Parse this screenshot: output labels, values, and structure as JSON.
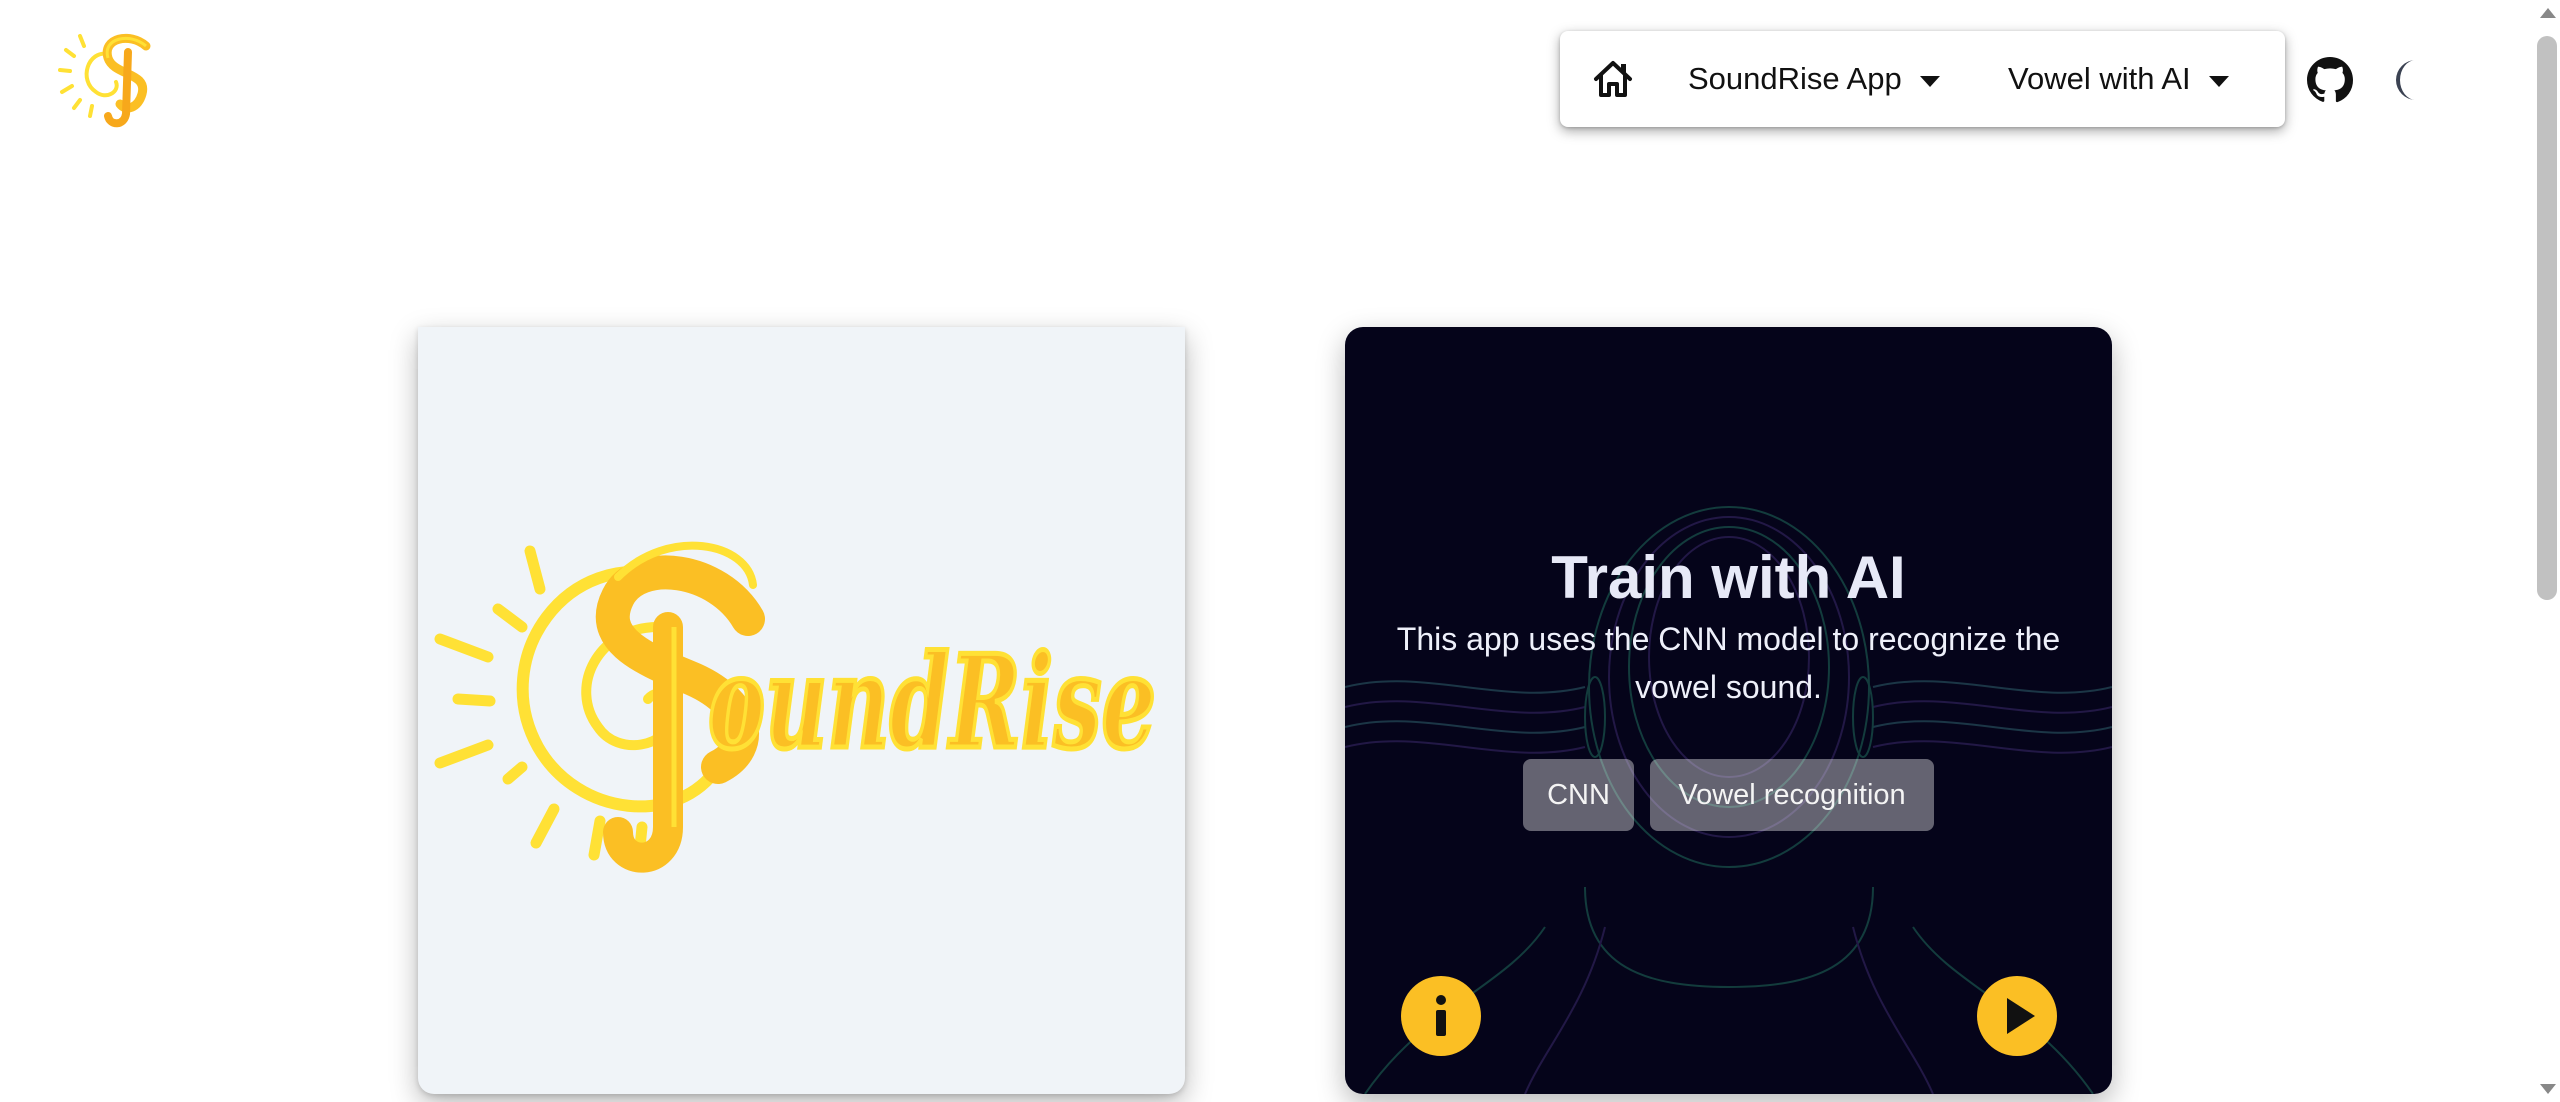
{
  "app": {
    "name": "SoundRise",
    "brand_color": "#fbbf24",
    "logo_color": "#ffe135"
  },
  "navbar": {
    "home_icon": "home-icon",
    "menu": [
      {
        "label": "SoundRise App"
      },
      {
        "label": "Vowel with AI"
      }
    ],
    "github_icon": "github-icon",
    "theme_toggle_icon": "moon-icon"
  },
  "cards": {
    "logo_card": {
      "logo_text": "SoundRise"
    },
    "ai_card": {
      "title": "Train with AI",
      "description": "This app uses the CNN model to recognize the vowel sound.",
      "tags": [
        "CNN",
        "Vowel recognition"
      ],
      "info_icon": "info-icon",
      "play_icon": "play-icon"
    }
  }
}
